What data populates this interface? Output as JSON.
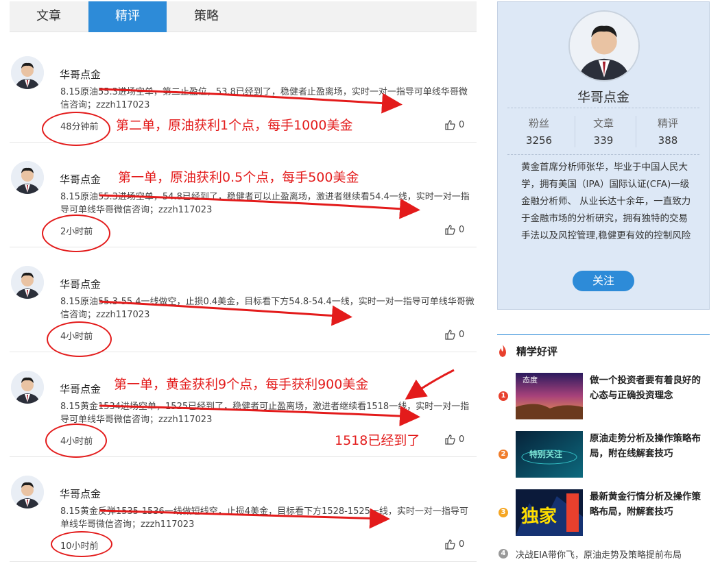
{
  "tabs": [
    {
      "label": "文章"
    },
    {
      "label": "精评"
    },
    {
      "label": "策略"
    }
  ],
  "posts": [
    {
      "author": "华哥点金",
      "text": "8.15原油55.3进场空单，第二止盈位，53.8已经到了，稳健者止盈离场，实时一对一指导可单线华哥微信咨询；zzzh117023",
      "time": "48分钟前",
      "likes": "0",
      "annotation": "第二单，原油获利1个点，每手1000美金"
    },
    {
      "author": "华哥点金",
      "text": "8.15原油55.3进场空单，54.8已经到了，稳健者可以止盈离场，激进者继续看54.4一线，实时一对一指导可单线华哥微信咨询；zzzh117023",
      "time": "2小时前",
      "likes": "0",
      "annotation": "第一单，原油获利0.5个点，每手500美金"
    },
    {
      "author": "华哥点金",
      "text": "8.15原油55.3-55.4一线做空，止损0.4美金，目标看下方54.8-54.4一线，实时一对一指导可单线华哥微信咨询；zzzh117023",
      "time": "4小时前",
      "likes": "0",
      "annotation": ""
    },
    {
      "author": "华哥点金",
      "text": "8.15黄金1534进场空单，1525已经到了，稳健者可止盈离场，激进者继续看1518一线，实时一对一指导可单线华哥微信咨询；zzzh117023",
      "time": "4小时前",
      "likes": "0",
      "annotation": "第一单，黄金获利9个点，每手获利900美金",
      "annotation2": "1518已经到了"
    },
    {
      "author": "华哥点金",
      "text": "8.15黄金反弹1535-1536一线做短线空，止损4美金，目标看下方1528-1525一线，实时一对一指导可单线华哥微信咨询；zzzh117023",
      "time": "10小时前",
      "likes": "0",
      "annotation": ""
    }
  ],
  "profile": {
    "name": "华哥点金",
    "stats": [
      {
        "label": "粉丝",
        "value": "3256"
      },
      {
        "label": "文章",
        "value": "339"
      },
      {
        "label": "精评",
        "value": "388"
      }
    ],
    "bio": "黄金首席分析师张华，毕业于中国人民大学，拥有美国（IPA）国际认证(CFA)一级金融分析师、 从业长达十余年，一直致力于金融市场的分析研究，拥有独特的交易手法以及风控管理,稳健更有效的控制风险",
    "follow_label": "关注"
  },
  "recommended": {
    "title": "精学好评",
    "items": [
      {
        "num": "1",
        "text": "做一个投资者要有着良好的心态与正确投资理念",
        "thumb_text": "态度",
        "color": "#e8402d"
      },
      {
        "num": "2",
        "text": "原油走势分析及操作策略布局，附在线解套技巧",
        "thumb_text": "特别关注",
        "color": "#f07d2b"
      },
      {
        "num": "3",
        "text": "最新黄金行情分析及操作策略布局，附解套技巧",
        "thumb_text": "独家",
        "color": "#f5a623"
      }
    ],
    "last": {
      "num": "4",
      "text": "决战EIA带你飞，原油走势及策略提前布局"
    }
  }
}
